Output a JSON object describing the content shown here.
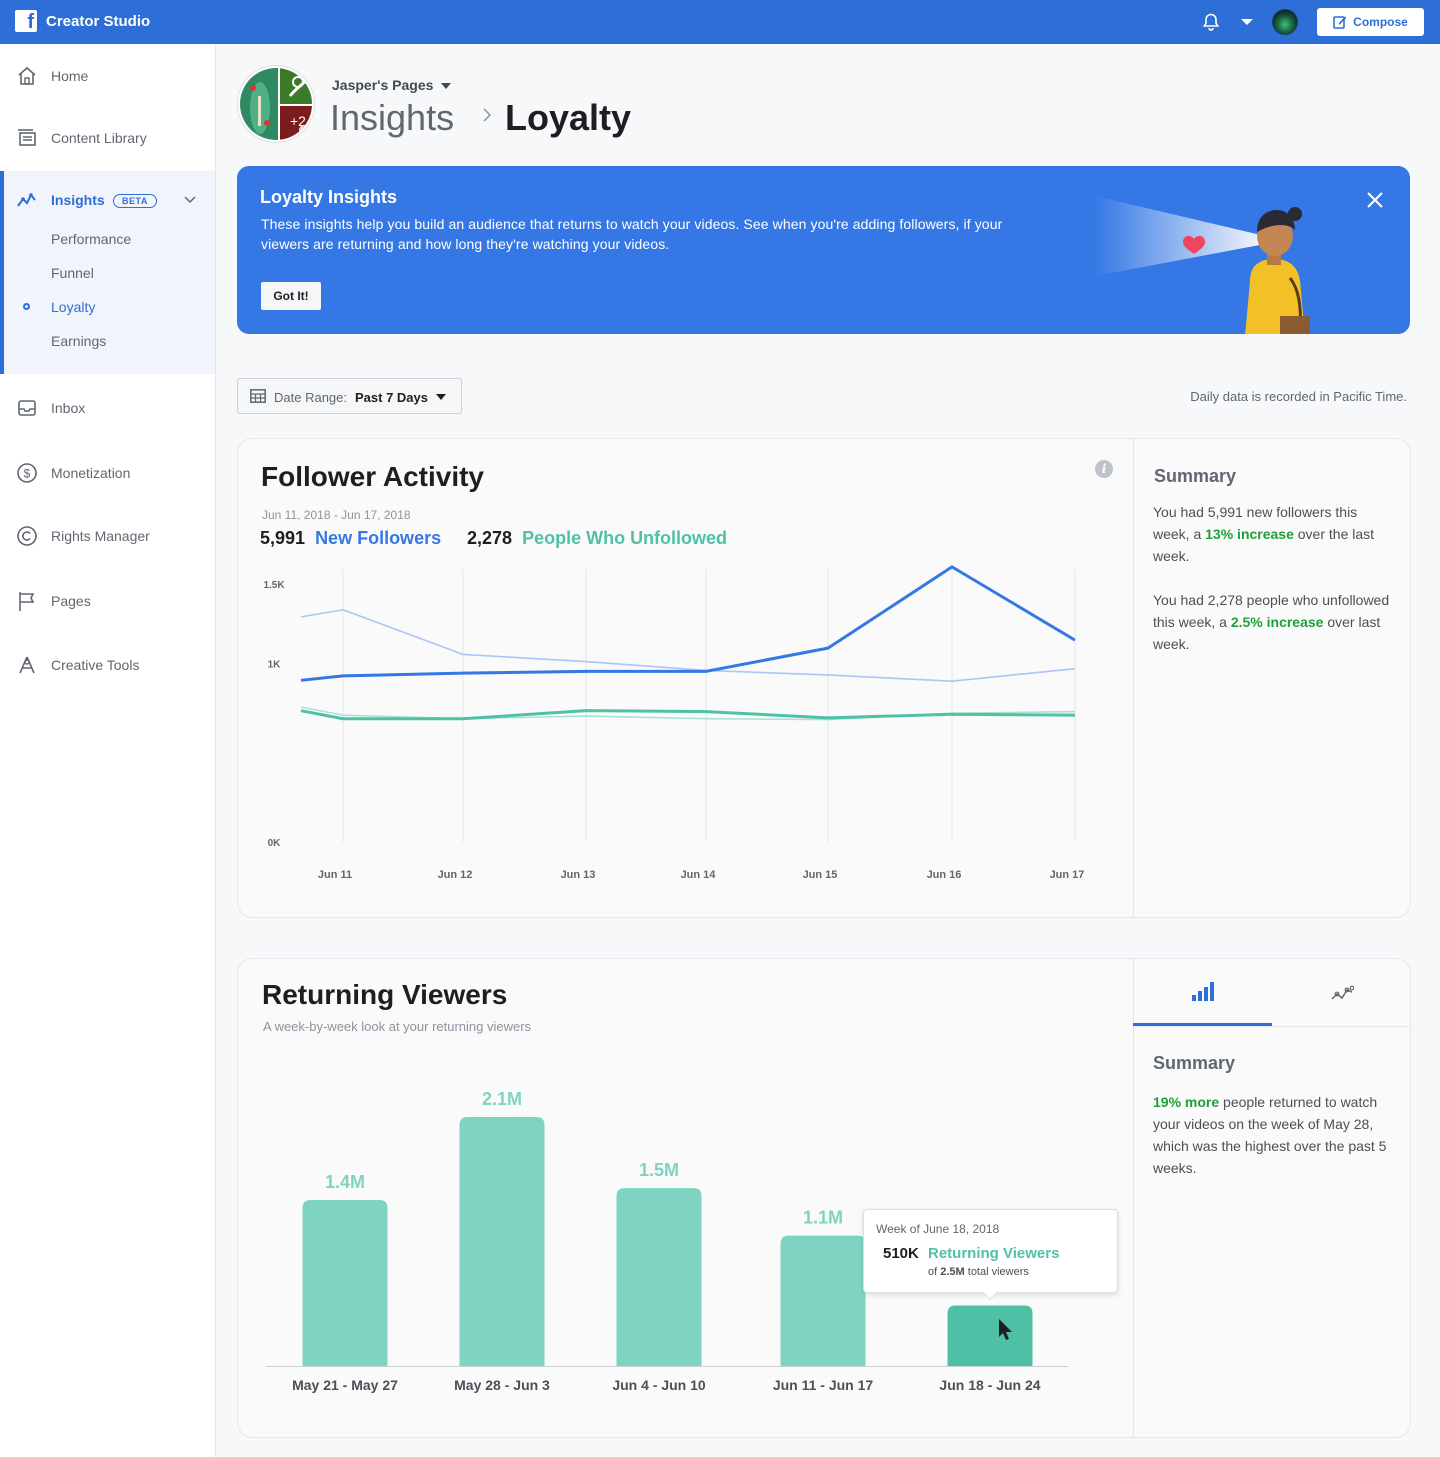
{
  "topbar": {
    "logo_glyph": "f",
    "app_title": "Creator Studio",
    "compose_label": "Compose",
    "brand_color": "#2d6fd6"
  },
  "sidebar": {
    "items": [
      {
        "label": "Home",
        "icon": "home-icon"
      },
      {
        "label": "Content Library",
        "icon": "content-library-icon"
      },
      {
        "label": "Insights",
        "icon": "insights-icon",
        "badge": "BETA"
      },
      {
        "label": "Inbox",
        "icon": "inbox-icon"
      },
      {
        "label": "Monetization",
        "icon": "dollar-icon"
      },
      {
        "label": "Rights Manager",
        "icon": "copyright-icon"
      },
      {
        "label": "Pages",
        "icon": "flag-icon"
      },
      {
        "label": "Creative Tools",
        "icon": "creative-tools-icon"
      }
    ],
    "insights_sub": [
      "Performance",
      "Funnel",
      "Loyalty",
      "Earnings"
    ],
    "active_sub": "Loyalty"
  },
  "header": {
    "page_name": "Jasper's Pages",
    "crumb_parent": "Insights",
    "crumb_current": "Loyalty"
  },
  "banner": {
    "title": "Loyalty Insights",
    "text": "These insights help you build an audience that returns to watch your videos. See when you're adding followers, if your viewers are returning and how long they're watching your videos.",
    "button": "Got It!"
  },
  "filters": {
    "date_range_label": "Date Range:",
    "date_range_value": "Past 7 Days",
    "timezone_note": "Daily data is recorded in Pacific Time."
  },
  "follower_activity": {
    "title": "Follower Activity",
    "date_span": "Jun 11, 2018 - Jun 17, 2018",
    "new_followers_value": "5,991",
    "new_followers_label": "New Followers",
    "unfollowed_value": "2,278",
    "unfollowed_label": "People Who Unfollowed",
    "summary_title": "Summary",
    "summary_p1_a": "You had 5,991 new followers this week, a ",
    "summary_p1_highlight": "13% increase",
    "summary_p1_b": " over the last week.",
    "summary_p2_a": "You had 2,278 people who unfollowed this week, a ",
    "summary_p2_highlight": "2.5% increase",
    "summary_p2_b": " over last week.",
    "colors": {
      "new": "#3578e5",
      "new_prev": "#aac6f5",
      "unfollow": "#4fc1a6",
      "unfollow_prev": "#a8e2d3"
    }
  },
  "returning_viewers": {
    "title": "Returning Viewers",
    "subtitle": "A week-by-week look at your returning viewers",
    "summary_title": "Summary",
    "summary_highlight": "19% more",
    "summary_text": " people returned to watch your videos on the week of May 28, which was the highest over the past 5 weeks.",
    "tabs": [
      {
        "icon": "bar-chart-icon",
        "active": true
      },
      {
        "icon": "line-chart-icon",
        "active": false
      }
    ],
    "tooltip": {
      "week": "Week of June 18, 2018",
      "value": "510K",
      "label": "Returning Viewers",
      "of_prefix": "of ",
      "of_total": "2.5M",
      "of_suffix": " total viewers"
    },
    "bar_color": "#7fd4c1",
    "bar_active_color": "#4fbfa5"
  },
  "chart_data": [
    {
      "type": "line",
      "title": "Follower Activity",
      "x": [
        "Jun 11",
        "Jun 12",
        "Jun 13",
        "Jun 14",
        "Jun 15",
        "Jun 16",
        "Jun 17"
      ],
      "x_extended_start": true,
      "ylim": [
        0,
        1500
      ],
      "yticks": [
        {
          "value": 1500,
          "label": "1.5K"
        },
        {
          "value": 1000,
          "label": "1K"
        },
        {
          "value": 0,
          "label": "0K"
        }
      ],
      "grid": "vertical",
      "series": [
        {
          "name": "New Followers",
          "values": [
            930,
            945,
            955,
            955,
            1085,
            1540,
            1130
          ],
          "lead": 905,
          "style": "bold",
          "color": "#3578e5"
        },
        {
          "name": "",
          "values": [
            1300,
            1050,
            1010,
            960,
            935,
            900,
            970
          ],
          "lead": 1260,
          "style": "light",
          "color": "#aac6f5"
        },
        {
          "name": "People Who Unfollowed",
          "values": [
            690,
            690,
            735,
            730,
            695,
            715,
            710
          ],
          "lead": 735,
          "style": "bold",
          "color": "#4fc1a6"
        },
        {
          "name": "",
          "values": [
            710,
            690,
            705,
            690,
            685,
            720,
            730
          ],
          "lead": 755,
          "style": "light",
          "color": "#a8e2d3"
        }
      ]
    },
    {
      "type": "bar",
      "title": "Returning Viewers",
      "categories": [
        "May 21 - May 27",
        "May 28 - Jun 3",
        "Jun 4 - Jun 10",
        "Jun 11 - Jun 17",
        "Jun 18 - Jun 24"
      ],
      "values": [
        1.4,
        2.1,
        1.5,
        1.1,
        0.51
      ],
      "value_labels": [
        "1.4M",
        "2.1M",
        "1.5M",
        "1.1M",
        ""
      ],
      "unit": "M",
      "ylim": [
        0,
        2.1
      ],
      "highlighted_index": 4
    }
  ]
}
